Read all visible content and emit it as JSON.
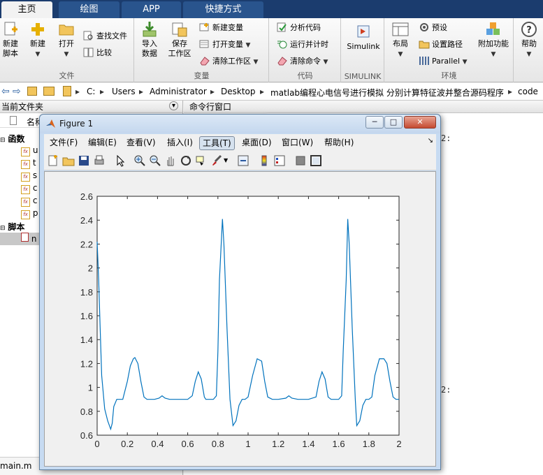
{
  "tabs": [
    {
      "label": "主页",
      "active": true
    },
    {
      "label": "绘图",
      "active": false
    },
    {
      "label": "APP",
      "active": false
    },
    {
      "label": "快捷方式",
      "active": false
    }
  ],
  "ribbon": {
    "file_section": {
      "title": "文件",
      "new_script": "新建\n脚本",
      "new": "新建",
      "open": "打开",
      "find_files": "查找文件",
      "compare": "比较"
    },
    "variable_section": {
      "title": "变量",
      "import_data": "导入\n数据",
      "save_workspace": "保存\n工作区",
      "new_variable": "新建变量",
      "open_variable": "打开变量",
      "clear_workspace": "清除工作区"
    },
    "code_section": {
      "title": "代码",
      "analyze_code": "分析代码",
      "run_and_time": "运行并计时",
      "clear_commands": "清除命令"
    },
    "simulink_section": {
      "title": "SIMULINK",
      "simulink": "Simulink"
    },
    "environment_section": {
      "title": "环境",
      "layout": "布局",
      "preferences": "预设",
      "set_path": "设置路径",
      "parallel": "Parallel",
      "addons": "附加功能"
    },
    "resources_section": {
      "help": "帮助"
    }
  },
  "address": {
    "crumbs": [
      "C:",
      "Users",
      "Administrator",
      "Desktop",
      "matlab编程心电信号进行模拟 分别计算特征波并整合源码程序",
      "code"
    ]
  },
  "left_panel": {
    "header": "当前文件夹",
    "name_column": "名称",
    "functions_group": "函数",
    "scripts_group": "脚本",
    "function_items": [
      "u",
      "t",
      "s",
      "c",
      "c",
      "p"
    ],
    "script_items": [
      "n"
    ],
    "status_file": "main.m"
  },
  "command_panel": {
    "header": "命令行窗口",
    "fragment1": "2:",
    "fragment2": "2:"
  },
  "figure_window": {
    "title": "Figure 1",
    "menus": [
      {
        "label": "文件(F)",
        "active": false
      },
      {
        "label": "编辑(E)",
        "active": false
      },
      {
        "label": "查看(V)",
        "active": false
      },
      {
        "label": "插入(I)",
        "active": false
      },
      {
        "label": "工具(T)",
        "active": true
      },
      {
        "label": "桌面(D)",
        "active": false
      },
      {
        "label": "窗口(W)",
        "active": false
      },
      {
        "label": "帮助(H)",
        "active": false
      }
    ],
    "min_button": "─",
    "max_button": "□",
    "close_button": "✕"
  },
  "chart_data": {
    "type": "line",
    "title": "",
    "xlabel": "",
    "ylabel": "",
    "xlim": [
      0,
      2
    ],
    "ylim": [
      0.6,
      2.6
    ],
    "xticks": [
      "0",
      "0.2",
      "0.4",
      "0.6",
      "0.8",
      "1",
      "1.2",
      "1.4",
      "1.6",
      "1.8",
      "2"
    ],
    "yticks": [
      "0.6",
      "0.8",
      "1",
      "1.2",
      "1.4",
      "1.6",
      "1.8",
      "2",
      "2.2",
      "2.4",
      "2.6"
    ],
    "grid": false,
    "color": "#0072bd",
    "series": [
      {
        "x": [
          0,
          0.01,
          0.02,
          0.03,
          0.05,
          0.07,
          0.09,
          0.1,
          0.11,
          0.13,
          0.15,
          0.17,
          0.2,
          0.22,
          0.24,
          0.25,
          0.27,
          0.29,
          0.31,
          0.33,
          0.38,
          0.41,
          0.43,
          0.45,
          0.48,
          0.55,
          0.6,
          0.63,
          0.65,
          0.67,
          0.69,
          0.71,
          0.72,
          0.74,
          0.77,
          0.79,
          0.8,
          0.81,
          0.83,
          0.84,
          0.86,
          0.88,
          0.9,
          0.92,
          0.94,
          0.96,
          0.98,
          1.0,
          1.03,
          1.06,
          1.09,
          1.11,
          1.13,
          1.16,
          1.2,
          1.25,
          1.27,
          1.29,
          1.33,
          1.4,
          1.45,
          1.47,
          1.49,
          1.51,
          1.53,
          1.55,
          1.57,
          1.6,
          1.62,
          1.63,
          1.65,
          1.66,
          1.67,
          1.69,
          1.71,
          1.72,
          1.74,
          1.76,
          1.78,
          1.8,
          1.82,
          1.84,
          1.87,
          1.9,
          1.92,
          1.94,
          1.96,
          1.98,
          2.0
        ],
        "y": [
          2.22,
          1.9,
          1.5,
          1.1,
          0.82,
          0.72,
          0.65,
          0.7,
          0.84,
          0.9,
          0.9,
          0.9,
          1.05,
          1.18,
          1.24,
          1.25,
          1.2,
          1.05,
          0.92,
          0.9,
          0.9,
          0.91,
          0.93,
          0.91,
          0.9,
          0.9,
          0.9,
          0.93,
          1.05,
          1.13,
          1.07,
          0.92,
          0.9,
          0.9,
          0.9,
          0.93,
          1.3,
          1.9,
          2.41,
          2.2,
          1.5,
          0.9,
          0.68,
          0.72,
          0.85,
          0.9,
          0.9,
          0.92,
          1.1,
          1.24,
          1.22,
          1.05,
          0.92,
          0.9,
          0.9,
          0.91,
          0.93,
          0.91,
          0.9,
          0.9,
          0.92,
          1.05,
          1.13,
          1.07,
          0.92,
          0.9,
          0.9,
          0.9,
          0.93,
          1.3,
          1.9,
          2.41,
          2.2,
          1.5,
          0.9,
          0.68,
          0.72,
          0.85,
          0.9,
          0.9,
          0.92,
          1.1,
          1.24,
          1.24,
          1.2,
          1.05,
          0.92,
          0.9,
          0.9
        ]
      }
    ]
  }
}
